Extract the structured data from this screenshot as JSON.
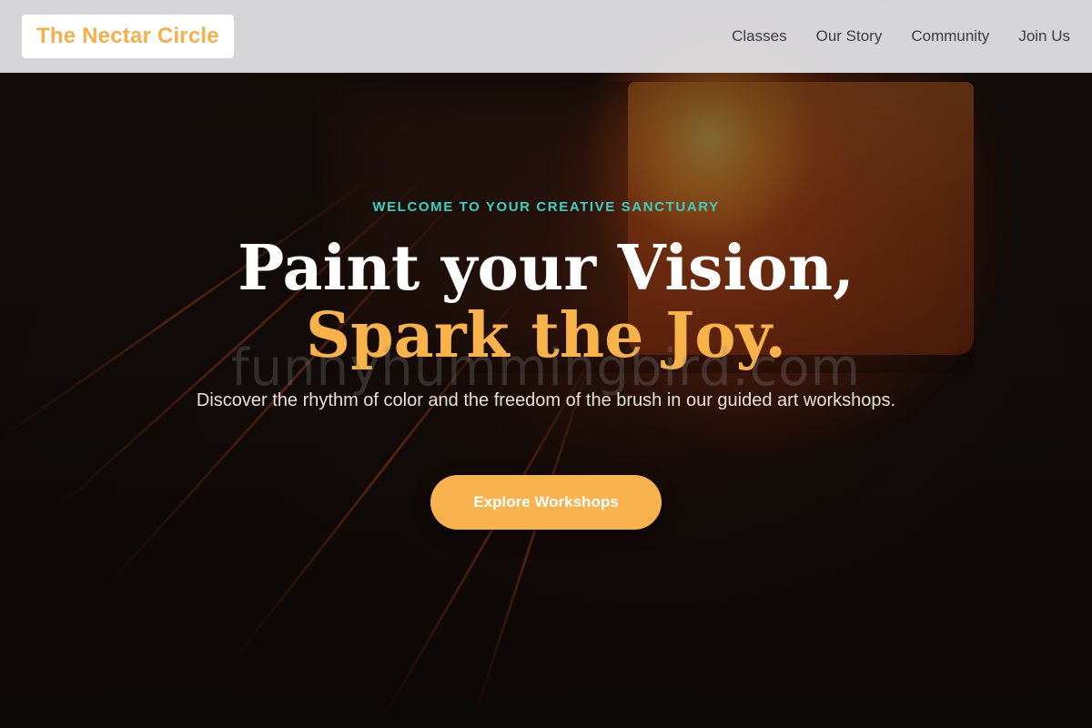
{
  "header": {
    "brand": "The Nectar Circle",
    "nav": [
      "Classes",
      "Our Story",
      "Community",
      "Join Us"
    ]
  },
  "hero": {
    "eyebrow": "WELCOME TO YOUR CREATIVE SANCTUARY",
    "headline_line1": "Paint your Vision,",
    "headline_line2": "Spark the Joy.",
    "watermark": "funnyhummingbird.com",
    "subtitle": "Discover the rhythm of color and the freedom of the brush in our guided art workshops.",
    "cta_label": "Explore Workshops"
  },
  "colors": {
    "accent": "#f8b24e",
    "eyebrow": "#3fd0c4",
    "header_bg": "#dedee0"
  }
}
